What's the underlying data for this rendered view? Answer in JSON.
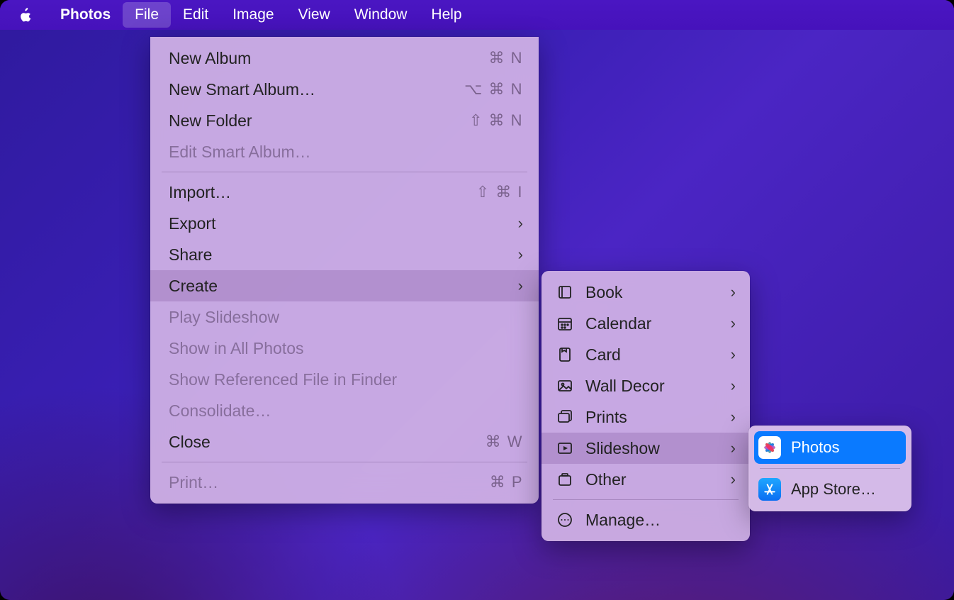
{
  "menubar": {
    "app": "Photos",
    "items": [
      "File",
      "Edit",
      "Image",
      "View",
      "Window",
      "Help"
    ],
    "open_index": 0
  },
  "file_menu": {
    "items": [
      {
        "label": "New Album",
        "shortcut": "⌘ N",
        "disabled": false
      },
      {
        "label": "New Smart Album…",
        "shortcut": "⌥ ⌘ N",
        "disabled": false
      },
      {
        "label": "New Folder",
        "shortcut": "⇧ ⌘ N",
        "disabled": false
      },
      {
        "label": "Edit Smart Album…",
        "shortcut": "",
        "disabled": true
      },
      {
        "sep": true
      },
      {
        "label": "Import…",
        "shortcut": "⇧ ⌘ I",
        "disabled": false
      },
      {
        "label": "Export",
        "submenu": true,
        "disabled": false
      },
      {
        "label": "Share",
        "submenu": true,
        "disabled": false
      },
      {
        "label": "Create",
        "submenu": true,
        "disabled": false,
        "hover": true
      },
      {
        "label": "Play Slideshow",
        "disabled": true
      },
      {
        "label": "Show in All Photos",
        "disabled": true
      },
      {
        "label": "Show Referenced File in Finder",
        "disabled": true
      },
      {
        "label": "Consolidate…",
        "disabled": true
      },
      {
        "label": "Close",
        "shortcut": "⌘ W",
        "disabled": false
      },
      {
        "sep": true
      },
      {
        "label": "Print…",
        "shortcut": "⌘ P",
        "disabled": true
      }
    ]
  },
  "create_menu": {
    "items": [
      {
        "icon": "book-icon",
        "label": "Book",
        "submenu": true
      },
      {
        "icon": "calendar-icon",
        "label": "Calendar",
        "submenu": true
      },
      {
        "icon": "card-icon",
        "label": "Card",
        "submenu": true
      },
      {
        "icon": "walldecor-icon",
        "label": "Wall Decor",
        "submenu": true
      },
      {
        "icon": "prints-icon",
        "label": "Prints",
        "submenu": true
      },
      {
        "icon": "slideshow-icon",
        "label": "Slideshow",
        "submenu": true,
        "hover": true
      },
      {
        "icon": "other-icon",
        "label": "Other",
        "submenu": true
      },
      {
        "sep": true
      },
      {
        "icon": "manage-icon",
        "label": "Manage…"
      }
    ]
  },
  "slideshow_menu": {
    "items": [
      {
        "icon": "photos-app-icon",
        "label": "Photos",
        "selected": true
      },
      {
        "sep": true
      },
      {
        "icon": "appstore-app-icon",
        "label": "App Store…"
      }
    ]
  }
}
